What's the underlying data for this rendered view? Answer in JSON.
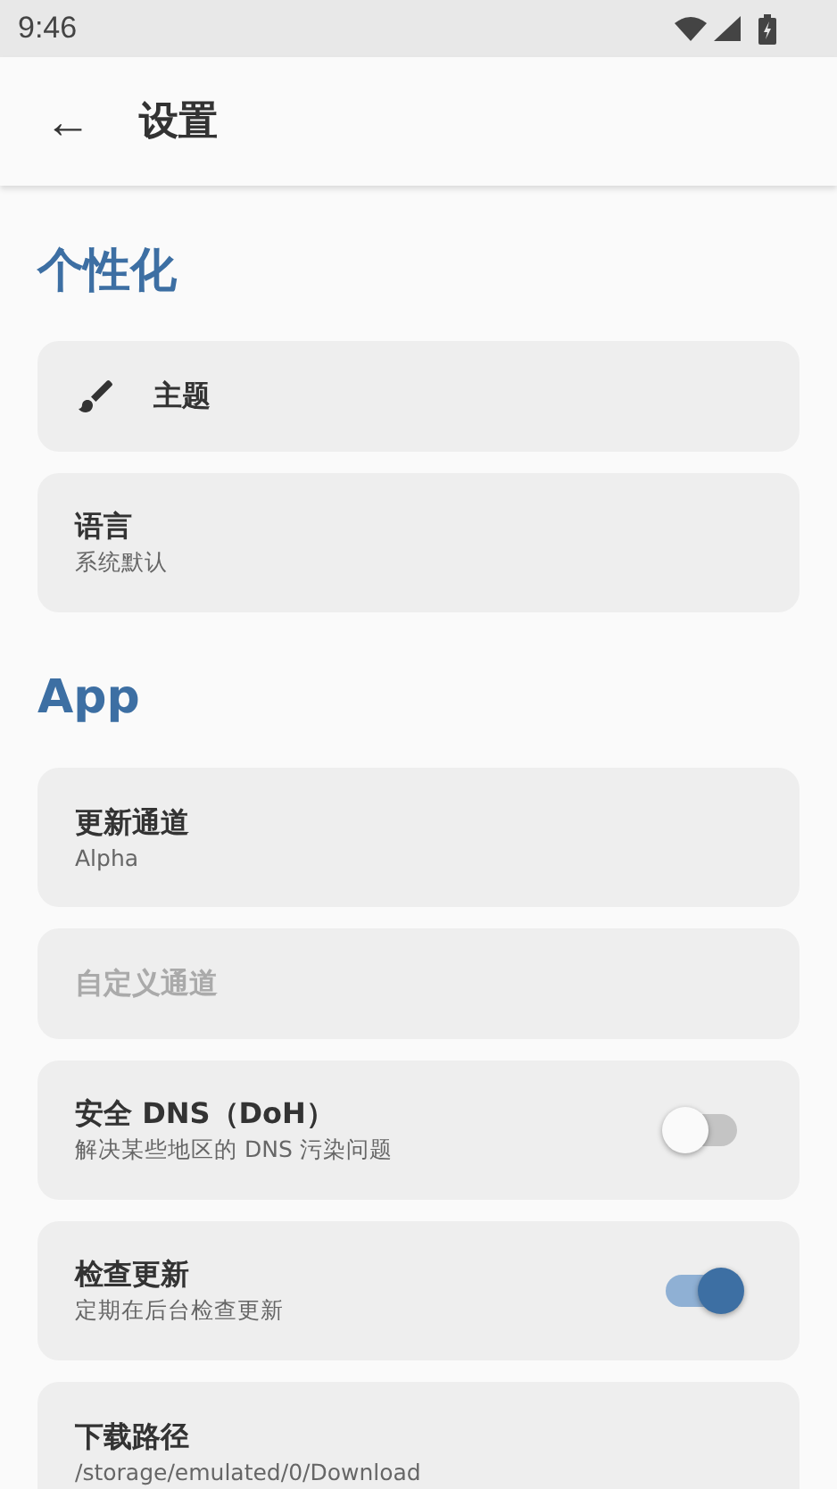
{
  "status_bar": {
    "time": "9:46"
  },
  "app_bar": {
    "back": "←",
    "title": "设置"
  },
  "sections": [
    {
      "title": "个性化",
      "items": [
        {
          "kind": "icon",
          "title": "主题",
          "disabled": false
        },
        {
          "kind": "text",
          "title": "语言",
          "subtitle": "系统默认",
          "disabled": false
        }
      ]
    },
    {
      "title": "App",
      "items": [
        {
          "kind": "text",
          "title": "更新通道",
          "subtitle": "Alpha",
          "disabled": false
        },
        {
          "kind": "text",
          "title": "自定义通道",
          "disabled": true
        },
        {
          "kind": "switch",
          "title": "安全 DNS（DoH）",
          "subtitle": "解决某些地区的 DNS 污染问题",
          "on": false,
          "disabled": false
        },
        {
          "kind": "switch",
          "title": "检查更新",
          "subtitle": "定期在后台检查更新",
          "on": true,
          "disabled": false
        },
        {
          "kind": "text",
          "title": "下载路径",
          "subtitle": "/storage/emulated/0/Download",
          "disabled": false
        }
      ]
    }
  ]
}
